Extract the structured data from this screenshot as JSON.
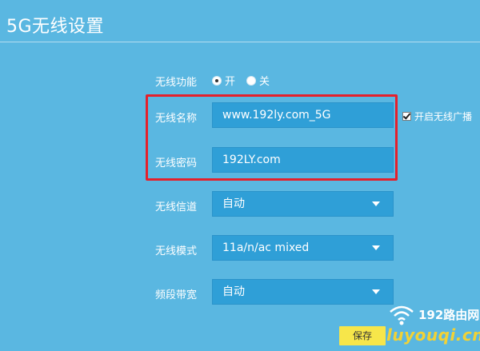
{
  "page": {
    "title": "5G无线设置"
  },
  "wireless_function": {
    "label": "无线功能",
    "options": [
      {
        "label": "开",
        "selected": true
      },
      {
        "label": "关",
        "selected": false
      }
    ]
  },
  "wireless_name": {
    "label": "无线名称",
    "value": "www.192ly.com_5G"
  },
  "broadcast": {
    "label": "开启无线广播",
    "checked": true
  },
  "wireless_password": {
    "label": "无线密码",
    "value": "192LY.com"
  },
  "wireless_channel": {
    "label": "无线信道",
    "value": "自动"
  },
  "wireless_mode": {
    "label": "无线模式",
    "value": "11a/n/ac mixed"
  },
  "bandwidth": {
    "label": "频段带宽",
    "value": "自动"
  },
  "actions": {
    "save_label": "保存"
  },
  "watermark": {
    "brand": "192路由网",
    "site": "luyouqi.cn"
  },
  "colors": {
    "background": "#5ab7e1",
    "input_bg": "#2f9fd7",
    "highlight": "#e5202b",
    "save_button": "#f7e64a"
  }
}
